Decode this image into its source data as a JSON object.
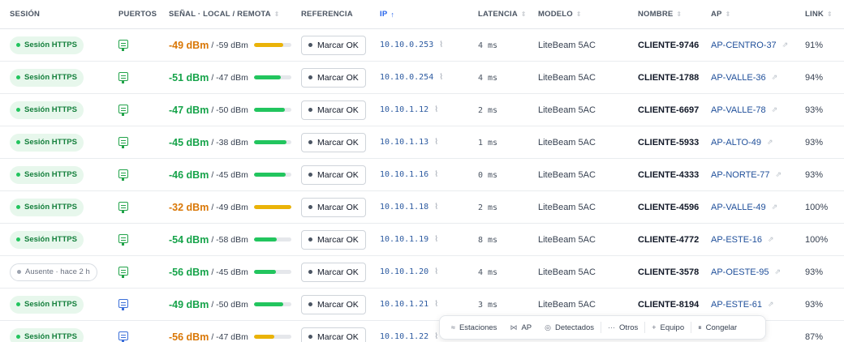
{
  "headers": {
    "session": "SESIÓN",
    "ports": "PUERTOS",
    "signal": "SEÑAL · LOCAL / REMOTA",
    "reference": "REFERENCIA",
    "ip": "IP",
    "latency": "LATENCIA",
    "model": "MODELO",
    "name": "NOMBRE",
    "ap": "AP",
    "link": "LINK"
  },
  "sort_indicators": {
    "neutral": "⇕",
    "ip_active": "↑"
  },
  "colors": {
    "good": "#16a34a",
    "warn": "#d97706",
    "bar_good": "#22c55e",
    "bar_warn": "#eab308"
  },
  "rows": [
    {
      "session": "Sesión HTTPS",
      "session_state": "ok",
      "port": "green",
      "local": "-49 dBm",
      "remote": "/ -59 dBm",
      "sig_state": "warn",
      "sig_level": 0.78,
      "ref": "Marcar OK",
      "ip": "10.10.0.253",
      "latency": "4 ms",
      "model": "LiteBeam 5AC",
      "name": "CLIENTE-9746",
      "ap": "AP-CENTRO-37",
      "link": "91%"
    },
    {
      "session": "Sesión HTTPS",
      "session_state": "ok",
      "port": "green",
      "local": "-51 dBm",
      "remote": "/ -47 dBm",
      "sig_state": "good",
      "sig_level": 0.72,
      "ref": "Marcar OK",
      "ip": "10.10.0.254",
      "latency": "4 ms",
      "model": "LiteBeam 5AC",
      "name": "CLIENTE-1788",
      "ap": "AP-VALLE-36",
      "link": "94%"
    },
    {
      "session": "Sesión HTTPS",
      "session_state": "ok",
      "port": "green",
      "local": "-47 dBm",
      "remote": "/ -50 dBm",
      "sig_state": "good",
      "sig_level": 0.82,
      "ref": "Marcar OK",
      "ip": "10.10.1.12",
      "latency": "2 ms",
      "model": "LiteBeam 5AC",
      "name": "CLIENTE-6697",
      "ap": "AP-VALLE-78",
      "link": "93%"
    },
    {
      "session": "Sesión HTTPS",
      "session_state": "ok",
      "port": "green",
      "local": "-45 dBm",
      "remote": "/ -38 dBm",
      "sig_state": "good",
      "sig_level": 0.88,
      "ref": "Marcar OK",
      "ip": "10.10.1.13",
      "latency": "1 ms",
      "model": "LiteBeam 5AC",
      "name": "CLIENTE-5933",
      "ap": "AP-ALTO-49",
      "link": "93%"
    },
    {
      "session": "Sesión HTTPS",
      "session_state": "ok",
      "port": "green",
      "local": "-46 dBm",
      "remote": "/ -45 dBm",
      "sig_state": "good",
      "sig_level": 0.85,
      "ref": "Marcar OK",
      "ip": "10.10.1.16",
      "latency": "0 ms",
      "model": "LiteBeam 5AC",
      "name": "CLIENTE-4333",
      "ap": "AP-NORTE-77",
      "link": "93%"
    },
    {
      "session": "Sesión HTTPS",
      "session_state": "ok",
      "port": "green",
      "local": "-32 dBm",
      "remote": "/ -49 dBm",
      "sig_state": "warn",
      "sig_level": 1.0,
      "ref": "Marcar OK",
      "ip": "10.10.1.18",
      "latency": "2 ms",
      "model": "LiteBeam 5AC",
      "name": "CLIENTE-4596",
      "ap": "AP-VALLE-49",
      "link": "100%"
    },
    {
      "session": "Sesión HTTPS",
      "session_state": "ok",
      "port": "green",
      "local": "-54 dBm",
      "remote": "/ -58 dBm",
      "sig_state": "good",
      "sig_level": 0.62,
      "ref": "Marcar OK",
      "ip": "10.10.1.19",
      "latency": "8 ms",
      "model": "LiteBeam 5AC",
      "name": "CLIENTE-4772",
      "ap": "AP-ESTE-16",
      "link": "100%"
    },
    {
      "session": "Ausente · hace 2 h",
      "session_state": "absent",
      "port": "green",
      "local": "-56 dBm",
      "remote": "/ -45 dBm",
      "sig_state": "good",
      "sig_level": 0.58,
      "ref": "Marcar OK",
      "ip": "10.10.1.20",
      "latency": "4 ms",
      "model": "LiteBeam 5AC",
      "name": "CLIENTE-3578",
      "ap": "AP-OESTE-95",
      "link": "93%"
    },
    {
      "session": "Sesión HTTPS",
      "session_state": "ok",
      "port": "blue",
      "local": "-49 dBm",
      "remote": "/ -50 dBm",
      "sig_state": "good",
      "sig_level": 0.78,
      "ref": "Marcar OK",
      "ip": "10.10.1.21",
      "latency": "3 ms",
      "model": "LiteBeam 5AC",
      "name": "CLIENTE-8194",
      "ap": "AP-ESTE-61",
      "link": "93%"
    },
    {
      "session": "Sesión HTTPS",
      "session_state": "ok",
      "port": "blue",
      "local": "-56 dBm",
      "remote": "/ -47 dBm",
      "sig_state": "warn",
      "sig_level": 0.55,
      "ref": "Marcar OK",
      "ip": "10.10.1.22",
      "latency": "",
      "model": "",
      "name": "",
      "ap": "",
      "link": "87%"
    }
  ],
  "toolbar": [
    {
      "icon": "≈",
      "icon_name": "stations-icon",
      "label": "Estaciones"
    },
    {
      "icon": "⋈",
      "icon_name": "ap-icon",
      "label": "AP"
    },
    {
      "icon": "◎",
      "icon_name": "detected-icon",
      "label": "Detectados"
    },
    {
      "icon": "···",
      "icon_name": "more-icon",
      "label": "Otros"
    },
    {
      "icon": "+",
      "icon_name": "add-icon",
      "label": "Equipo"
    },
    {
      "icon": "⏸",
      "icon_name": "pause-icon",
      "label": "Congelar"
    }
  ]
}
